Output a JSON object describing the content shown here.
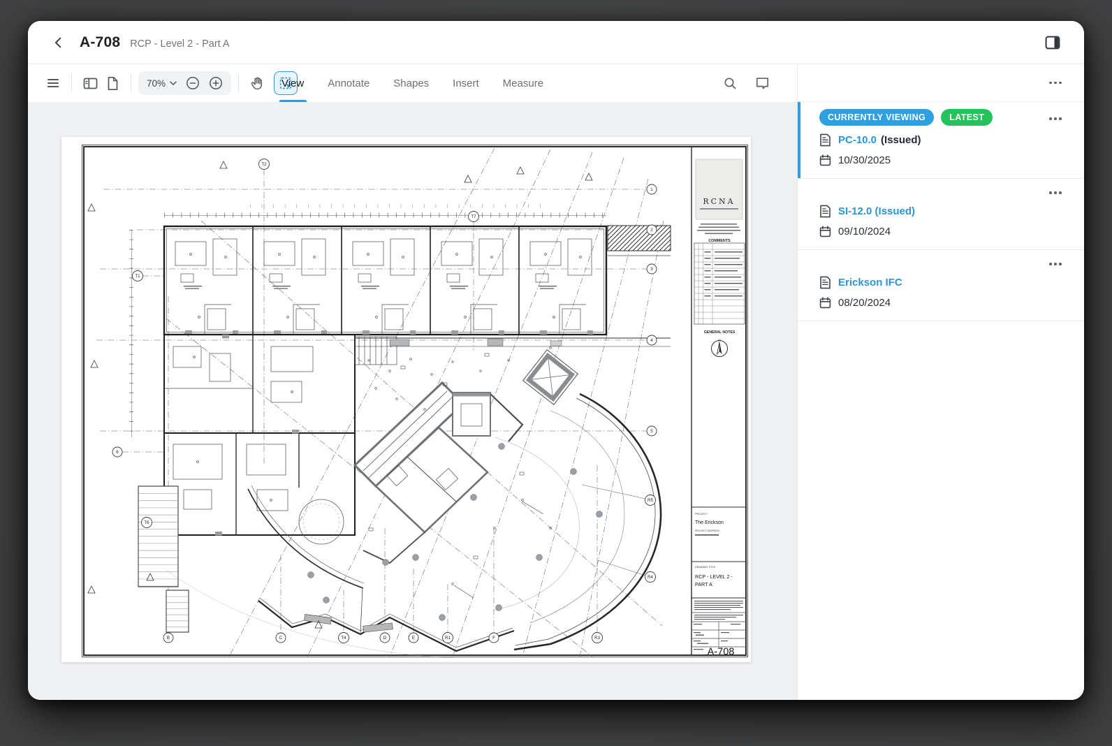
{
  "header": {
    "title": "A-708",
    "subtitle": "RCP - Level 2 - Part A"
  },
  "toolbar": {
    "zoom_value": "70%",
    "tabs": [
      {
        "label": "View",
        "active": true
      },
      {
        "label": "Annotate",
        "active": false
      },
      {
        "label": "Shapes",
        "active": false
      },
      {
        "label": "Insert",
        "active": false
      },
      {
        "label": "Measure",
        "active": false
      }
    ]
  },
  "icons": {
    "back": "chevron-left",
    "panel_toggle": "panel-right-filled",
    "menu": "hamburger",
    "thumbnails": "panel-left",
    "page": "document",
    "zoom_dropdown": "chevron-down",
    "zoom_out": "minus-circle",
    "zoom_in": "plus-circle",
    "pan": "hand",
    "select": "marquee-dashed",
    "search": "magnifier",
    "comment": "speech-bubble",
    "version_file": "document-lines",
    "version_date": "calendar",
    "more": "ellipsis-dots"
  },
  "versions": [
    {
      "badges": [
        "CURRENTLY VIEWING",
        "LATEST"
      ],
      "name": "PC-10.0",
      "name_suffix": "(Issued)",
      "date": "10/30/2025"
    },
    {
      "name": "SI-12.0 (Issued)",
      "date": "09/10/2024"
    },
    {
      "name": "Erickson IFC",
      "date": "08/20/2024"
    }
  ],
  "sheet": {
    "logo": "RCNA",
    "comments_title": "COMMENTS",
    "general_notes": "GENERAL NOTES",
    "north_label": "N",
    "project_label": "PROJECT",
    "project_name": "The Erickson",
    "project_address_label": "PROJECT ADDRESS",
    "drawing_title_label": "DRAWING TITLE",
    "drawing_title_line1": "RCP - LEVEL 2 -",
    "drawing_title_line2": "PART A",
    "sheet_number": "A-708",
    "grid_right": [
      "1",
      "2",
      "3",
      "4",
      "5",
      "R5",
      "R4"
    ],
    "grid_bottom": [
      "B",
      "C",
      "T4",
      "D",
      "E",
      "R1",
      "F",
      "R3"
    ],
    "grid_top": [
      "T2",
      "T7"
    ],
    "grid_left": [
      "T1",
      "6",
      "T6"
    ]
  },
  "colors": {
    "accent_blue": "#2b9be2",
    "badge_green": "#24c25a",
    "canvas_bg": "#f0f1f3",
    "link_blue": "#2a95d8"
  }
}
